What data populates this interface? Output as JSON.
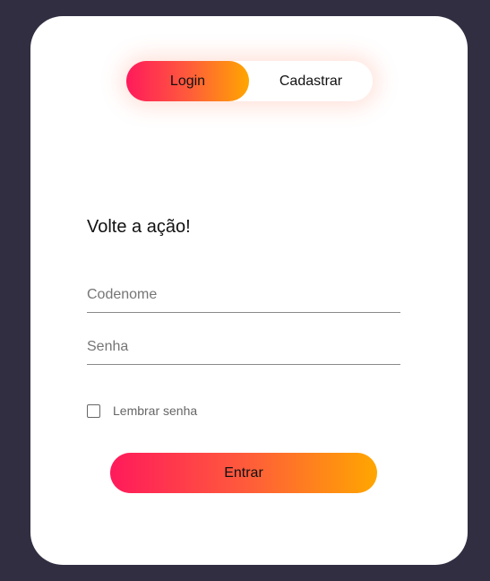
{
  "colors": {
    "page_background": "#322e42",
    "card_background": "#ffffff",
    "gradient_start": "#ff1a5b",
    "gradient_end": "#ffa600"
  },
  "toggle": {
    "login_label": "Login",
    "signup_label": "Cadastrar",
    "active": "login"
  },
  "form": {
    "heading": "Volte a ação!",
    "codename_placeholder": "Codenome",
    "password_placeholder": "Senha",
    "remember_label": "Lembrar senha",
    "remember_checked": false,
    "submit_label": "Entrar"
  }
}
